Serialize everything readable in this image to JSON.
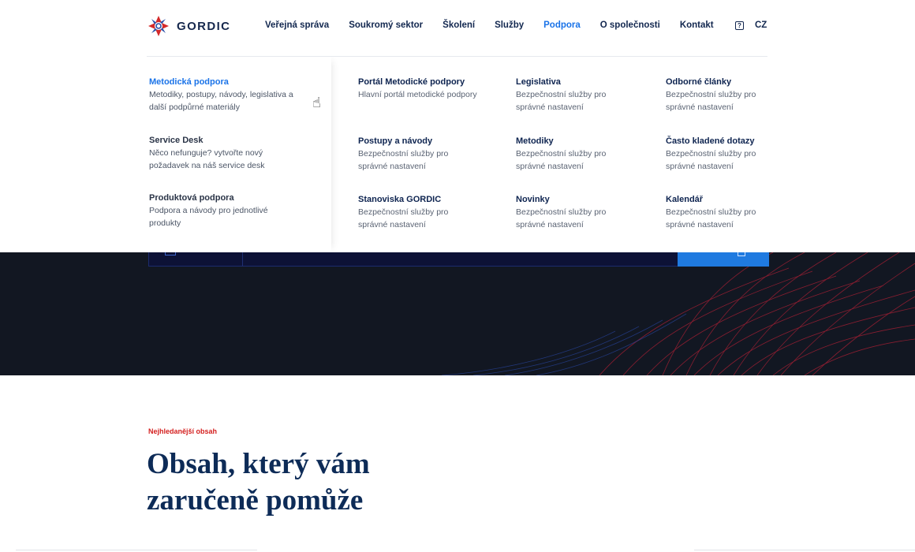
{
  "header": {
    "logo_text": "GORDIC",
    "nav": [
      "Veřejná správa",
      "Soukromý sektor",
      "Školení",
      "Služby",
      "Podpora",
      "O společnosti",
      "Kontakt"
    ],
    "active_nav": "Podpora",
    "help_label": "?",
    "lang": "CZ"
  },
  "menu": {
    "left": [
      {
        "title": "Metodická podpora",
        "desc": "Metodiky, postupy, návody, legislativa a další podpůrné materiály"
      },
      {
        "title": "Service Desk",
        "desc": "Něco nefunguje? vytvořte  nový požadavek na náš service desk"
      },
      {
        "title": "Produktová podpora",
        "desc": "Podpora a návody pro jednotlivé produkty"
      }
    ],
    "links": [
      {
        "title": "Portál Metodické podpory",
        "desc": "Hlavní portál metodické podpory"
      },
      {
        "title": "Legislativa",
        "desc": "Bezpečnostní služby pro správné nastavení"
      },
      {
        "title": "Odborné články",
        "desc": "Bezpečnostní služby pro správné nastavení"
      },
      {
        "title": "Postupy a návody",
        "desc": "Bezpečnostní služby pro správné nastavení"
      },
      {
        "title": "Metodiky",
        "desc": "Bezpečnostní služby pro správné nastavení"
      },
      {
        "title": "Často kladené dotazy",
        "desc": "Bezpečnostní služby pro správné nastavení"
      },
      {
        "title": "Stanoviska GORDIC",
        "desc": "Bezpečnostní služby pro správné nastavení"
      },
      {
        "title": "Novinky",
        "desc": "Bezpečnostní služby pro správné nastavení"
      },
      {
        "title": "Kalendář",
        "desc": "Bezpečnostní služby pro správné nastavení"
      }
    ]
  },
  "content": {
    "eyebrow": "Nejhledanější obsah",
    "headline": "Obsah, který vám zaručeně pomůže"
  },
  "colors": {
    "accent": "#1a73e8",
    "navy": "#0d2b57",
    "eyebrow_red": "#d4201f",
    "hero_bg": "#121722"
  }
}
